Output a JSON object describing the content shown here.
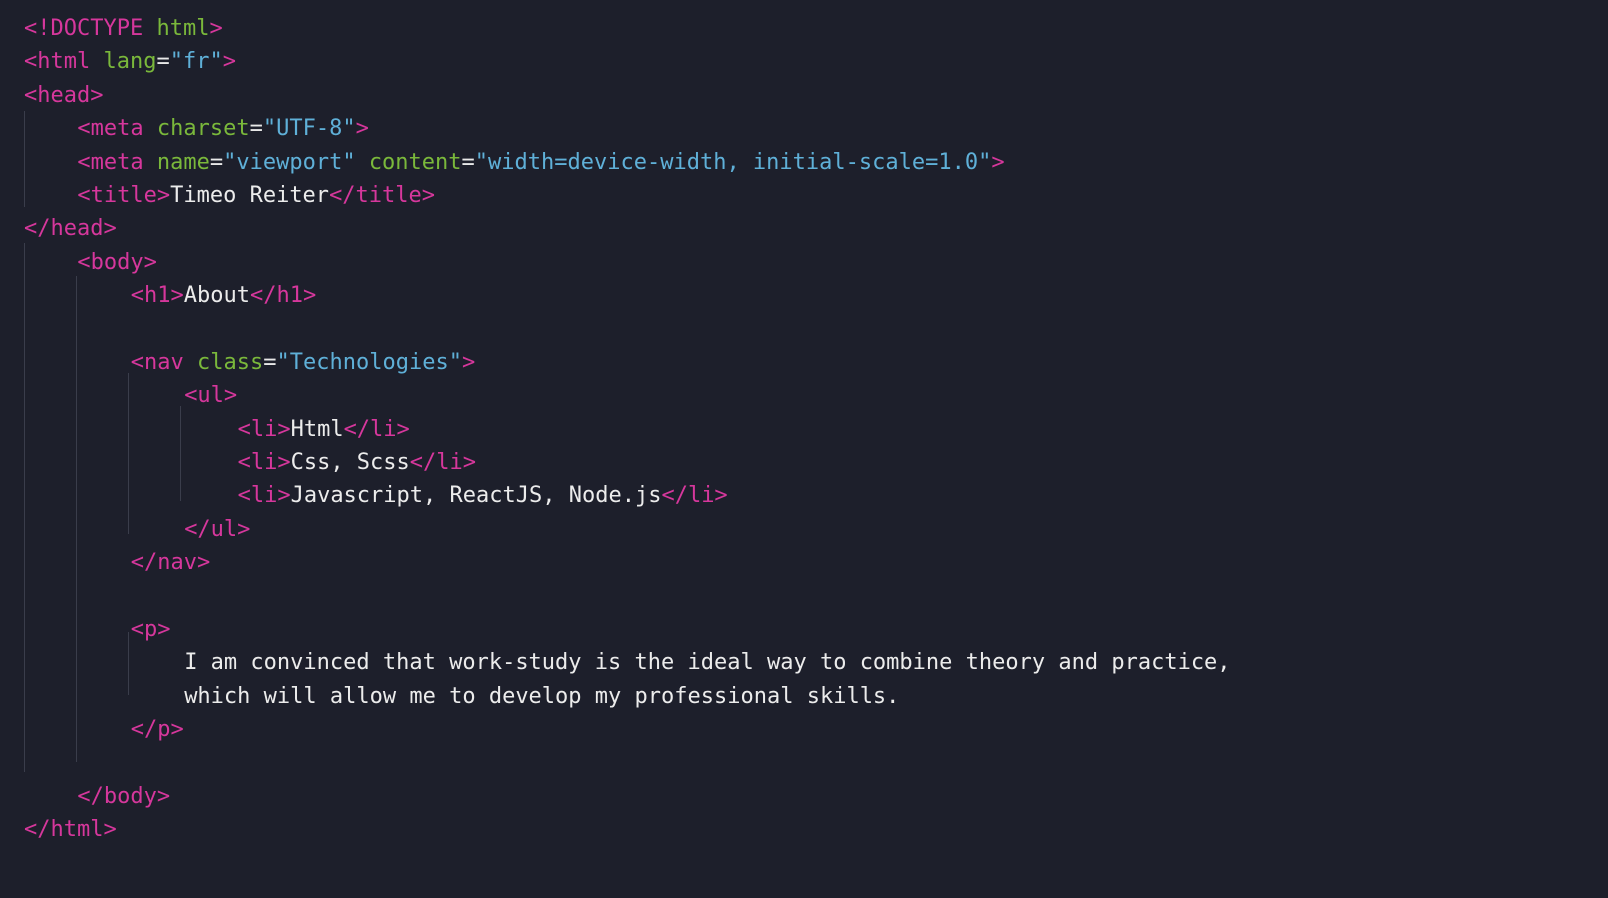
{
  "editor": {
    "theme": {
      "background": "#1d1f2b",
      "tag": "#d6379c",
      "attribute": "#7ab83b",
      "string": "#5fb0d8",
      "text": "#ececec",
      "indent_guide": "#3a3d4b"
    },
    "lines": [
      {
        "indent": 0,
        "tokens": [
          {
            "t": "tag",
            "v": "<!DOCTYPE "
          },
          {
            "t": "attr",
            "v": "html"
          },
          {
            "t": "tag",
            "v": ">"
          }
        ]
      },
      {
        "indent": 0,
        "tokens": [
          {
            "t": "tag",
            "v": "<html "
          },
          {
            "t": "attr",
            "v": "lang"
          },
          {
            "t": "eq",
            "v": "="
          },
          {
            "t": "str",
            "v": "\"fr\""
          },
          {
            "t": "tag",
            "v": ">"
          }
        ]
      },
      {
        "indent": 0,
        "tokens": [
          {
            "t": "tag",
            "v": "<head>"
          }
        ]
      },
      {
        "indent": 1,
        "tokens": [
          {
            "t": "tag",
            "v": "<meta "
          },
          {
            "t": "attr",
            "v": "charset"
          },
          {
            "t": "eq",
            "v": "="
          },
          {
            "t": "str",
            "v": "\"UTF-8\""
          },
          {
            "t": "tag",
            "v": ">"
          }
        ]
      },
      {
        "indent": 1,
        "tokens": [
          {
            "t": "tag",
            "v": "<meta "
          },
          {
            "t": "attr",
            "v": "name"
          },
          {
            "t": "eq",
            "v": "="
          },
          {
            "t": "str",
            "v": "\"viewport\""
          },
          {
            "t": "eq",
            "v": " "
          },
          {
            "t": "attr",
            "v": "content"
          },
          {
            "t": "eq",
            "v": "="
          },
          {
            "t": "str",
            "v": "\"width=device-width, initial-scale=1.0\""
          },
          {
            "t": "tag",
            "v": ">"
          }
        ]
      },
      {
        "indent": 1,
        "tokens": [
          {
            "t": "tag",
            "v": "<title>"
          },
          {
            "t": "txt",
            "v": "Timeo Reiter"
          },
          {
            "t": "tag",
            "v": "</title>"
          }
        ]
      },
      {
        "indent": 0,
        "tokens": [
          {
            "t": "tag",
            "v": "</head>"
          }
        ]
      },
      {
        "indent": 1,
        "tokens": [
          {
            "t": "tag",
            "v": "<body>"
          }
        ]
      },
      {
        "indent": 2,
        "tokens": [
          {
            "t": "tag",
            "v": "<h1>"
          },
          {
            "t": "txt",
            "v": "About"
          },
          {
            "t": "tag",
            "v": "</h1>"
          }
        ]
      },
      {
        "indent": 0,
        "tokens": []
      },
      {
        "indent": 2,
        "tokens": [
          {
            "t": "tag",
            "v": "<nav "
          },
          {
            "t": "attr",
            "v": "class"
          },
          {
            "t": "eq",
            "v": "="
          },
          {
            "t": "str",
            "v": "\"Technologies\""
          },
          {
            "t": "tag",
            "v": ">"
          }
        ]
      },
      {
        "indent": 3,
        "tokens": [
          {
            "t": "tag",
            "v": "<ul>"
          }
        ]
      },
      {
        "indent": 4,
        "tokens": [
          {
            "t": "tag",
            "v": "<li>"
          },
          {
            "t": "txt",
            "v": "Html"
          },
          {
            "t": "tag",
            "v": "</li>"
          }
        ]
      },
      {
        "indent": 4,
        "tokens": [
          {
            "t": "tag",
            "v": "<li>"
          },
          {
            "t": "txt",
            "v": "Css, Scss"
          },
          {
            "t": "tag",
            "v": "</li>"
          }
        ]
      },
      {
        "indent": 4,
        "tokens": [
          {
            "t": "tag",
            "v": "<li>"
          },
          {
            "t": "txt",
            "v": "Javascript, ReactJS, Node.js"
          },
          {
            "t": "tag",
            "v": "</li>"
          }
        ]
      },
      {
        "indent": 3,
        "tokens": [
          {
            "t": "tag",
            "v": "</ul>"
          }
        ]
      },
      {
        "indent": 2,
        "tokens": [
          {
            "t": "tag",
            "v": "</nav>"
          }
        ]
      },
      {
        "indent": 0,
        "tokens": []
      },
      {
        "indent": 2,
        "tokens": [
          {
            "t": "tag",
            "v": "<p>"
          }
        ]
      },
      {
        "indent": 3,
        "tokens": [
          {
            "t": "txt",
            "v": "I am convinced that work-study is the ideal way to combine theory and practice,"
          }
        ]
      },
      {
        "indent": 3,
        "tokens": [
          {
            "t": "txt",
            "v": "which will allow me to develop my professional skills."
          }
        ]
      },
      {
        "indent": 2,
        "tokens": [
          {
            "t": "tag",
            "v": "</p>"
          }
        ]
      },
      {
        "indent": 0,
        "tokens": []
      },
      {
        "indent": 1,
        "tokens": [
          {
            "t": "tag",
            "v": "</body>"
          }
        ]
      },
      {
        "indent": 0,
        "tokens": [
          {
            "t": "tag",
            "v": "</html>"
          }
        ]
      }
    ]
  }
}
